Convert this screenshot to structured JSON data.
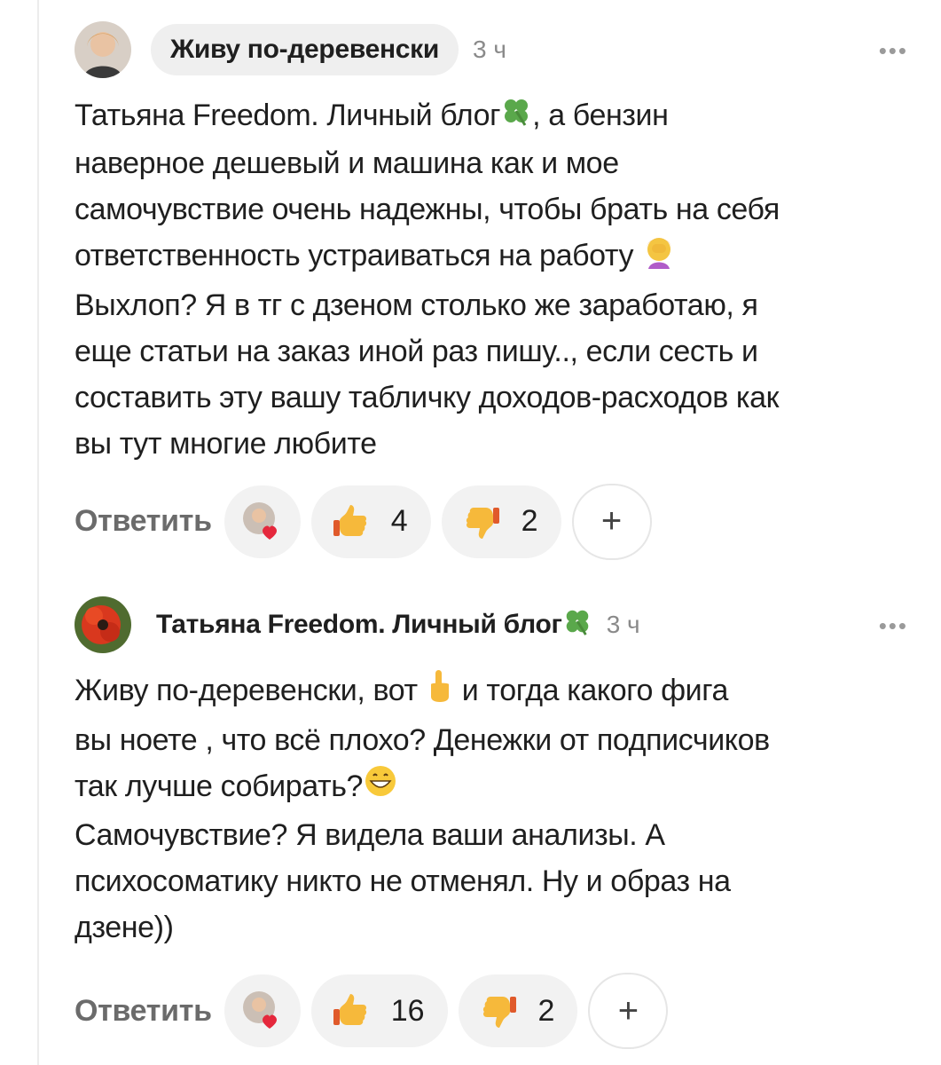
{
  "comments": [
    {
      "author": "Живу по-деревенски",
      "time": "3 ч",
      "more": "•••",
      "text_line1": "Татьяна Freedom. Личный блог",
      "text_rest": ", а бензин\nнаверное дешевый и машина как и мое\nсамочувствие очень надежны, чтобы брать на себя\nответственность устраиваться на работу",
      "text_after": "\nВыхлоп? Я в тг с дзеном столько же заработаю, я\nеще статьи на заказ иной раз пишу.., если сесть и\nсоставить эту вашу табличку доходов-расходов как\nвы тут многие любите",
      "reply_label": "Ответить",
      "likes": "4",
      "dislikes": "2",
      "plus": "+"
    },
    {
      "author": "Татьяна Freedom. Личный блог",
      "time": "3 ч",
      "more": "•••",
      "text_a": "Живу по-деревенски, вот ",
      "text_b": " и тогда какого фига\nвы ноете , что всё плохо? Денежки от подписчиков\nтак лучше собирать?",
      "text_c": "\nСамочувствие? Я видела ваши анализы. А\nпсихосоматику никто не отменял. Ну и образ на\nдзене))",
      "reply_label": "Ответить",
      "likes": "16",
      "dislikes": "2",
      "plus": "+"
    }
  ],
  "icons": {
    "clover": "clover-icon",
    "facepalm": "facepalm-emoji",
    "pointing_up": "pointing-up-emoji",
    "grin": "grin-emoji",
    "like": "thumbs-up-icon",
    "dislike": "thumbs-down-icon",
    "heart": "heart-icon"
  }
}
